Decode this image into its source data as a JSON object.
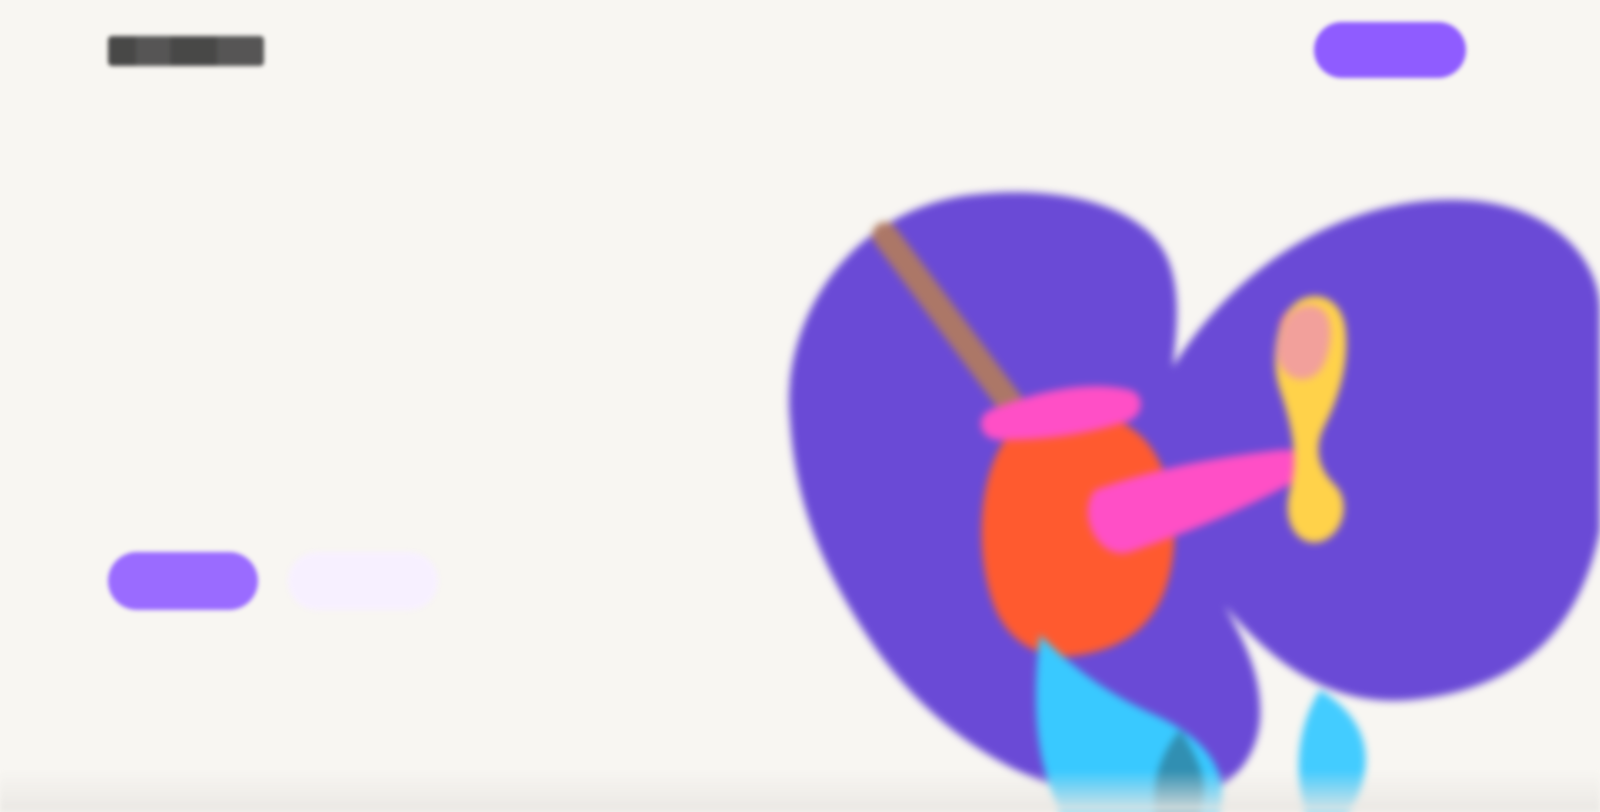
{
  "header": {
    "logo_name": "logo",
    "nav": [
      {
        "label": ""
      },
      {
        "label": ""
      },
      {
        "label": ""
      }
    ],
    "cta_label": ""
  },
  "hero": {
    "title_line1": "",
    "title_highlight": "",
    "title_rest": "",
    "description": "",
    "primary_button": "",
    "secondary_button": ""
  },
  "illustration": {
    "name": "hero-illustration",
    "blob_color": "#6a4ad6",
    "accent_colors": [
      "#ff4fc6",
      "#ff5a2f",
      "#39c9ff",
      "#ffd24a",
      "#f2a09b"
    ]
  },
  "colors": {
    "background": "#f8f6f2",
    "primary": "#8f5cff",
    "secondary_button_bg": "#f7f0ff",
    "highlight_underline": "#f5c77b",
    "heading_text": "#222222",
    "body_text": "#555555"
  }
}
